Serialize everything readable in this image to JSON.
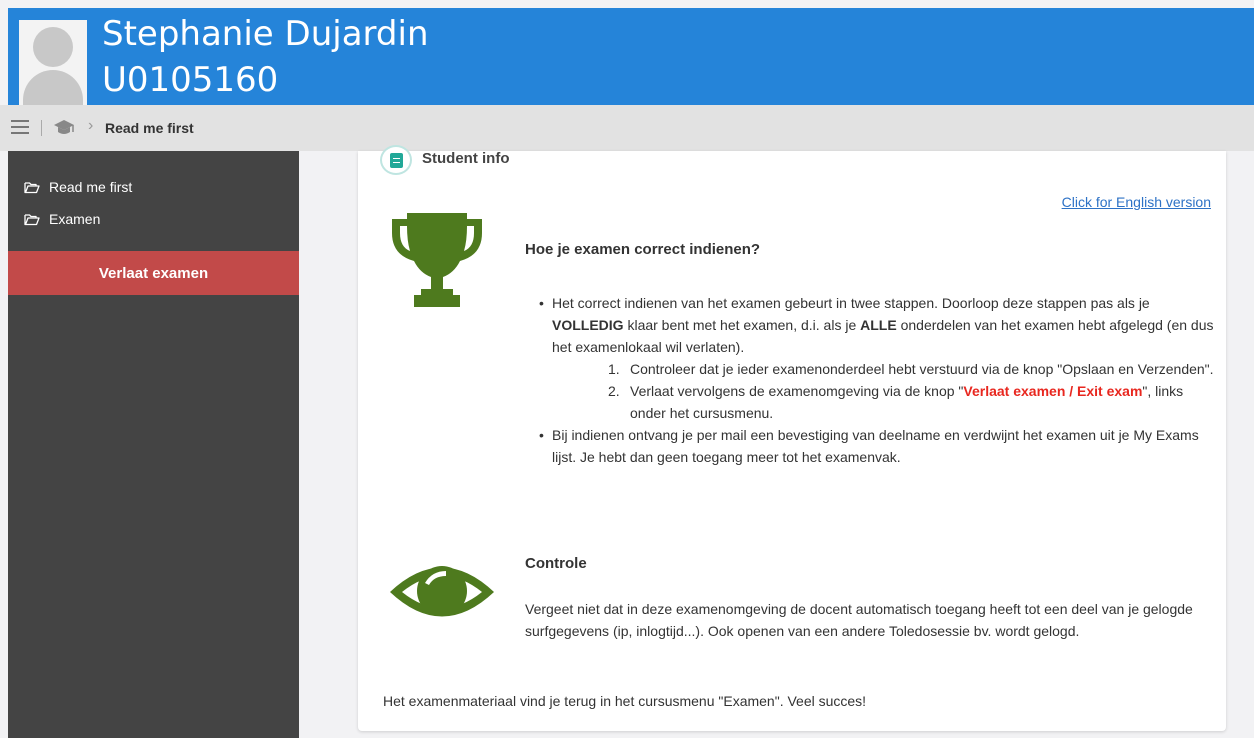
{
  "header": {
    "name": "Stephanie Dujardin",
    "student_id": "U0105160"
  },
  "breadcrumb": {
    "current": "Read me first"
  },
  "sidebar": {
    "items": [
      {
        "label": "Read me first",
        "icon": "folder-open-icon"
      },
      {
        "label": "Examen",
        "icon": "folder-open-icon"
      }
    ],
    "exit_label": "Verlaat examen"
  },
  "card": {
    "title": "Student info",
    "lang_link": "Click for English version",
    "section1": {
      "heading": "Hoe je examen correct indienen?",
      "bullet1_part1": "Het correct indienen van het examen gebeurt in twee stappen. Doorloop deze stappen pas als je ",
      "bullet1_bold1": "VOLLEDIG",
      "bullet1_part2": " klaar bent met het examen, d.i. als je ",
      "bullet1_bold2": "ALLE",
      "bullet1_part3": " onderdelen van het examen hebt afgelegd (en dus het examenlokaal wil verlaten).",
      "steps": [
        {
          "num": "1.",
          "text_before": "Controleer dat je ieder examenonderdeel hebt verstuurd via de knop \"Opslaan en Verzenden\".",
          "highlight": "",
          "text_after": ""
        },
        {
          "num": "2.",
          "text_before": "Verlaat vervolgens de examenomgeving via de knop \"",
          "highlight": "Verlaat examen / Exit exam",
          "text_after": "\", links onder het cursusmenu."
        }
      ],
      "bullet2": "Bij indienen ontvang je per mail een bevestiging van deelname en verdwijnt het examen uit je My Exams lijst. Je hebt dan geen toegang meer tot het examenvak."
    },
    "section2": {
      "heading": "Controle",
      "text": "Vergeet niet dat in deze examenomgeving de docent automatisch toegang heeft tot een deel van je gelogde surfgegevens (ip, inlogtijd...). Ook openen van een andere Toledosessie bv. wordt gelogd."
    },
    "footer": "Het examenmateriaal vind je terug in het cursusmenu \"Examen\". Veel succes!"
  },
  "colors": {
    "header_bg": "#2584d9",
    "sidebar_bg": "#444444",
    "exit_button_bg": "#c24a49",
    "icon_green": "#4e7a1e",
    "link_blue": "#2d72c6",
    "highlight_red": "#e8271f"
  },
  "icons": {
    "avatar": "user-avatar-icon",
    "menu": "hamburger-menu-icon",
    "breadcrumb_home": "graduation-cap-icon",
    "card_badge": "document-icon",
    "trophy": "trophy-icon",
    "eye": "eye-icon"
  }
}
